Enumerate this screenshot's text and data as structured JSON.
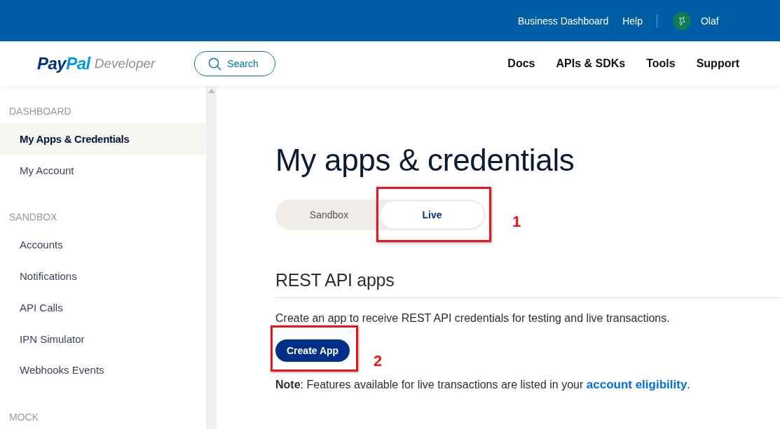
{
  "top_bar": {
    "links": [
      "Business Dashboard",
      "Help"
    ],
    "user": "Olaf"
  },
  "header": {
    "logo": {
      "brand_first": "Pay",
      "brand_second": "Pal",
      "product": "Developer"
    },
    "search": "Search",
    "nav": [
      "Docs",
      "APIs & SDKs",
      "Tools",
      "Support"
    ]
  },
  "sidebar": {
    "sections": [
      {
        "heading": "DASHBOARD",
        "items": [
          {
            "label": "My Apps & Credentials",
            "selected": true
          },
          {
            "label": "My Account",
            "selected": false
          }
        ]
      },
      {
        "heading": "SANDBOX",
        "items": [
          {
            "label": "Accounts",
            "selected": false
          },
          {
            "label": "Notifications",
            "selected": false
          },
          {
            "label": "API Calls",
            "selected": false
          },
          {
            "label": "IPN Simulator",
            "selected": false
          },
          {
            "label": "Webhooks Events",
            "selected": false
          }
        ]
      },
      {
        "heading": "MOCK"
      }
    ]
  },
  "main": {
    "title": "My apps & credentials",
    "tabs": [
      {
        "label": "Sandbox",
        "selected": false
      },
      {
        "label": "Live",
        "selected": true
      }
    ],
    "section_title": "REST API apps",
    "description": "Create an app to receive REST API credentials for testing and live transactions.",
    "button": "Create App",
    "note": "**Note**: Features available for live transactions are listed in your",
    "note_link": "account eligibility",
    "note_end": "."
  },
  "annotations": [
    {
      "label": "1"
    },
    {
      "label": "2"
    }
  ]
}
